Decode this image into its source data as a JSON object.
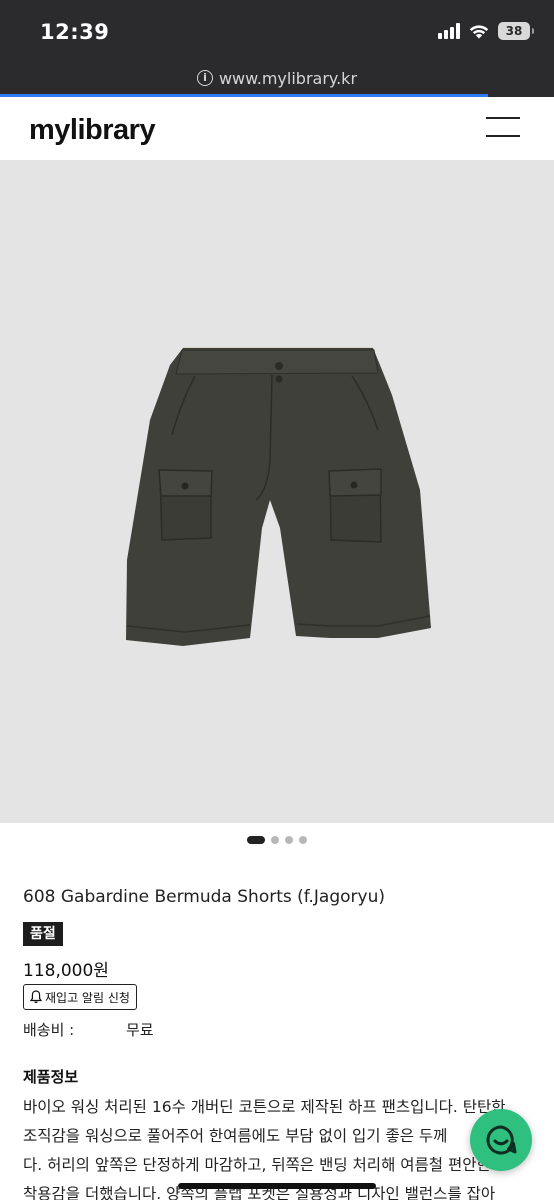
{
  "status_bar": {
    "time": "12:39",
    "battery": "38",
    "icons": [
      "signal-icon",
      "wifi-icon",
      "battery-icon"
    ]
  },
  "browser": {
    "url": "www.mylibrary.kr",
    "page_load_progress": 0.88
  },
  "header": {
    "logo": "mylibrary",
    "menu_icon": "hamburger-menu-icon"
  },
  "product": {
    "image_alt": "shorts-product-photo",
    "carousel": {
      "count": 4,
      "active_index": 0
    },
    "title": "608 Gabardine Bermuda Shorts (f.Jagoryu)",
    "badge": "품절",
    "price": "118,000원",
    "restock_button": "재입고 알림 신청",
    "shipping_label": "배송비 :",
    "shipping_value": "무료"
  },
  "description": {
    "heading": "제품정보",
    "text": "바이오 워싱 처리된 16수 개버딘 코튼으로 제작된 하프 팬츠입니다. 탄탄한\n조직감을 워싱으로 풀어주어 한여름에도 부담 없이 입기 좋은 두께\n다. 허리의 앞쪽은 단정하게 마감하고, 뒤쪽은 밴딩 처리해 여름철 편안한\n착용감을 더했습니다. 양쪽의 플랩 포켓은 실용성과 디자인 밸런스를 잡아"
  },
  "colors": {
    "status_bar_bg": "#2b2b2e",
    "progress": "#2f7bf5",
    "chat_fab": "#2fbf7f",
    "product_bg": "#e4e4e4",
    "shorts": "#3f403a"
  }
}
